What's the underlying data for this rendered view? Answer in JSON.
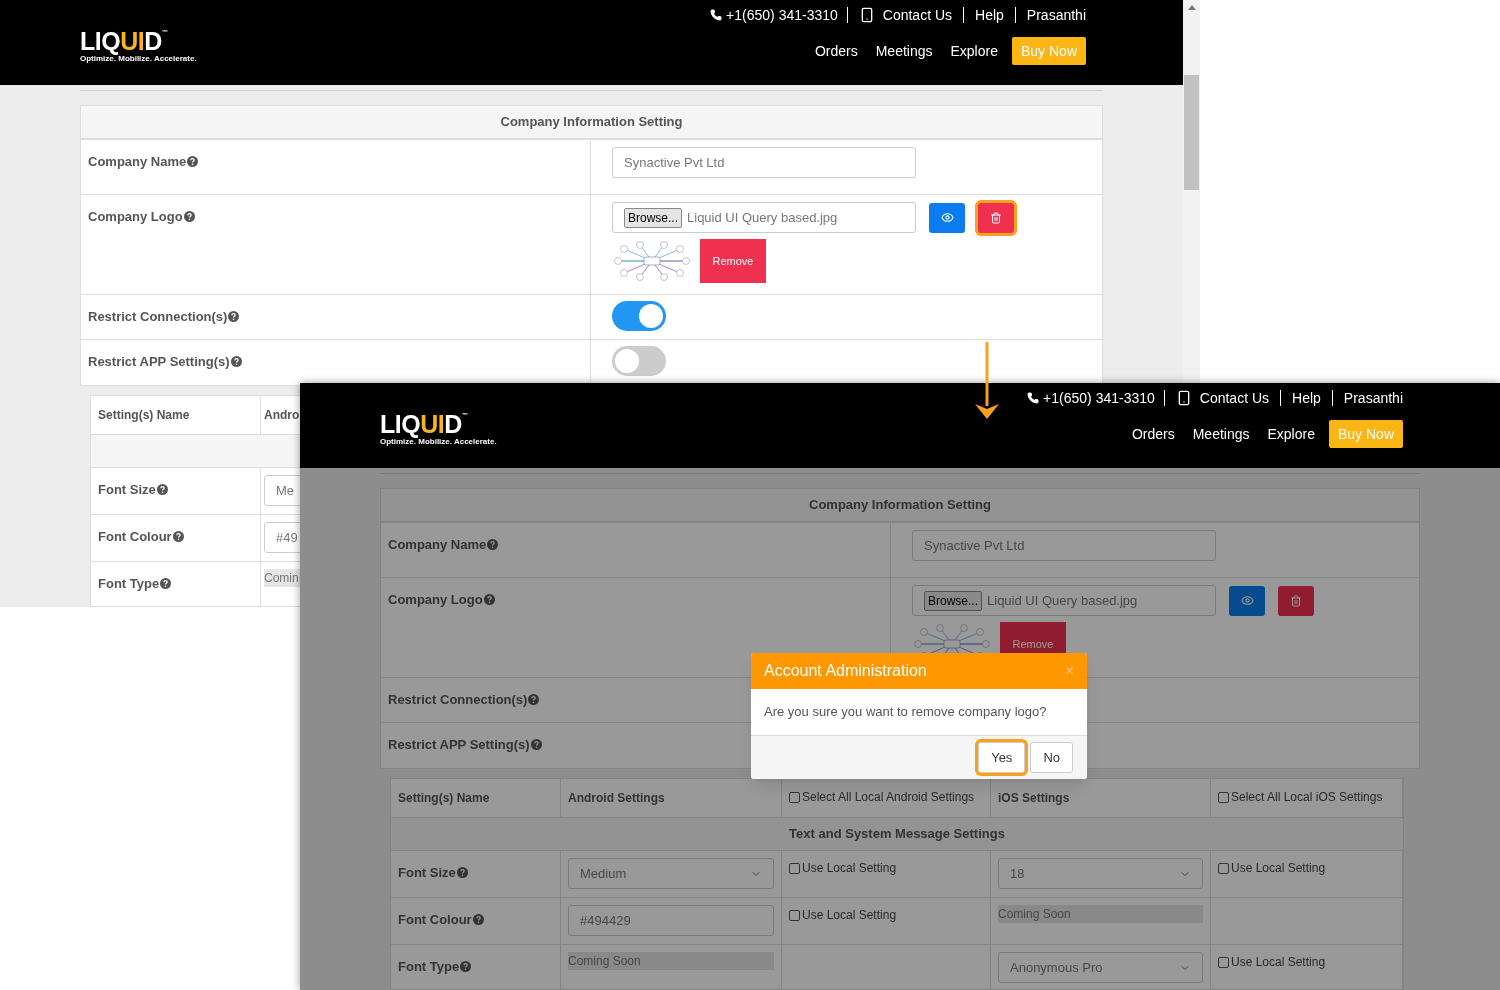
{
  "screenshots": [
    {
      "header": {
        "logo": [
          {
            "text": "LIQ",
            "accent": false
          },
          {
            "text": "UI",
            "accent": true
          },
          {
            "text": "D",
            "accent": false
          }
        ],
        "trademark": "™",
        "tagline": "Optimize. Mobilize. Accelerate.",
        "phone": "+1(650) 341-3310",
        "links": [
          {
            "label": "Contact Us",
            "kind": "contact"
          },
          {
            "label": "Help",
            "kind": "plain"
          },
          {
            "label": "Prasanthi",
            "kind": "plain"
          }
        ],
        "nav": [
          "Orders",
          "Meetings",
          "Explore"
        ],
        "cta": "Buy Now"
      },
      "company": {
        "title": "Company Information Setting",
        "rows": [
          {
            "label": "Company Name",
            "kind": "text",
            "value": "Synactive Pvt Ltd"
          },
          {
            "label": "Company Logo",
            "kind": "file",
            "browse": "Browse...",
            "filename": "Liquid UI Query based.jpg",
            "remove": "Remove",
            "delete_highlighted": true
          },
          {
            "label": "Restrict Connection(s)",
            "kind": "toggle",
            "on": true
          },
          {
            "label": "Restrict APP Setting(s)",
            "kind": "toggle",
            "on": false
          }
        ]
      },
      "settings": {
        "header": [
          {
            "kind": "text",
            "text": "Setting(s) Name"
          },
          {
            "kind": "text",
            "text": "Andro"
          }
        ],
        "rows": [
          {
            "label": "Font Size",
            "cells": [
              {
                "kind": "input",
                "value": "Me"
              }
            ]
          },
          {
            "label": "Font Colour",
            "cells": [
              {
                "kind": "input",
                "value": "#49"
              }
            ]
          },
          {
            "label": "Font Type",
            "cells": [
              {
                "kind": "coming_soon",
                "text": "Comin"
              }
            ]
          }
        ]
      }
    },
    {
      "header": {
        "logo": [
          {
            "text": "LIQ",
            "accent": false
          },
          {
            "text": "UI",
            "accent": true
          },
          {
            "text": "D",
            "accent": false
          }
        ],
        "trademark": "™",
        "tagline": "Optimize. Mobilize. Accelerate.",
        "phone": "+1(650) 341-3310",
        "links": [
          {
            "label": "Contact Us",
            "kind": "contact"
          },
          {
            "label": "Help",
            "kind": "plain"
          },
          {
            "label": "Prasanthi",
            "kind": "plain"
          }
        ],
        "nav": [
          "Orders",
          "Meetings",
          "Explore"
        ],
        "cta": "Buy Now"
      },
      "company": {
        "title": "Company Information Setting",
        "rows": [
          {
            "label": "Company Name",
            "kind": "text",
            "value": "Synactive Pvt Ltd"
          },
          {
            "label": "Company Logo",
            "kind": "file",
            "browse": "Browse...",
            "filename": "Liquid UI Query based.jpg",
            "remove": "Remove",
            "delete_highlighted": false
          },
          {
            "label": "Restrict Connection(s)",
            "kind": "label"
          },
          {
            "label": "Restrict APP Setting(s)",
            "kind": "label"
          }
        ]
      },
      "settings": {
        "header": [
          {
            "kind": "text",
            "text": "Setting(s) Name"
          },
          {
            "kind": "text",
            "text": "Android Settings"
          },
          {
            "kind": "checkbox",
            "label": "Select All Local Android Settings",
            "checked": false
          },
          {
            "kind": "text",
            "text": "iOS Settings"
          },
          {
            "kind": "checkbox",
            "label": "Select All Local iOS Settings",
            "checked": false
          }
        ],
        "section": "Text and System Message Settings",
        "rows": [
          {
            "label": "Font Size",
            "cells": [
              {
                "kind": "select",
                "value": "Medium"
              },
              {
                "kind": "checkbox",
                "label": "Use Local Setting",
                "checked": false
              },
              {
                "kind": "select",
                "value": "18"
              },
              {
                "kind": "checkbox",
                "label": "Use Local Setting",
                "checked": false
              }
            ]
          },
          {
            "label": "Font Colour",
            "cells": [
              {
                "kind": "input",
                "value": "#494429"
              },
              {
                "kind": "checkbox",
                "label": "Use Local Setting",
                "checked": false
              },
              {
                "kind": "coming_soon",
                "text": "Coming Soon"
              },
              {
                "kind": "empty"
              }
            ]
          },
          {
            "label": "Font Type",
            "cells": [
              {
                "kind": "coming_soon",
                "text": "Coming Soon"
              },
              {
                "kind": "empty"
              },
              {
                "kind": "select",
                "value": "Anonymous Pro"
              },
              {
                "kind": "checkbox",
                "label": "Use Local Setting",
                "checked": false
              }
            ]
          }
        ]
      },
      "dialog": {
        "title": "Account Administration",
        "close": "×",
        "message": "Are you sure you want to remove company logo?",
        "buttons": [
          {
            "label": "Yes",
            "highlighted": true
          },
          {
            "label": "No",
            "highlighted": false
          }
        ]
      }
    }
  ]
}
